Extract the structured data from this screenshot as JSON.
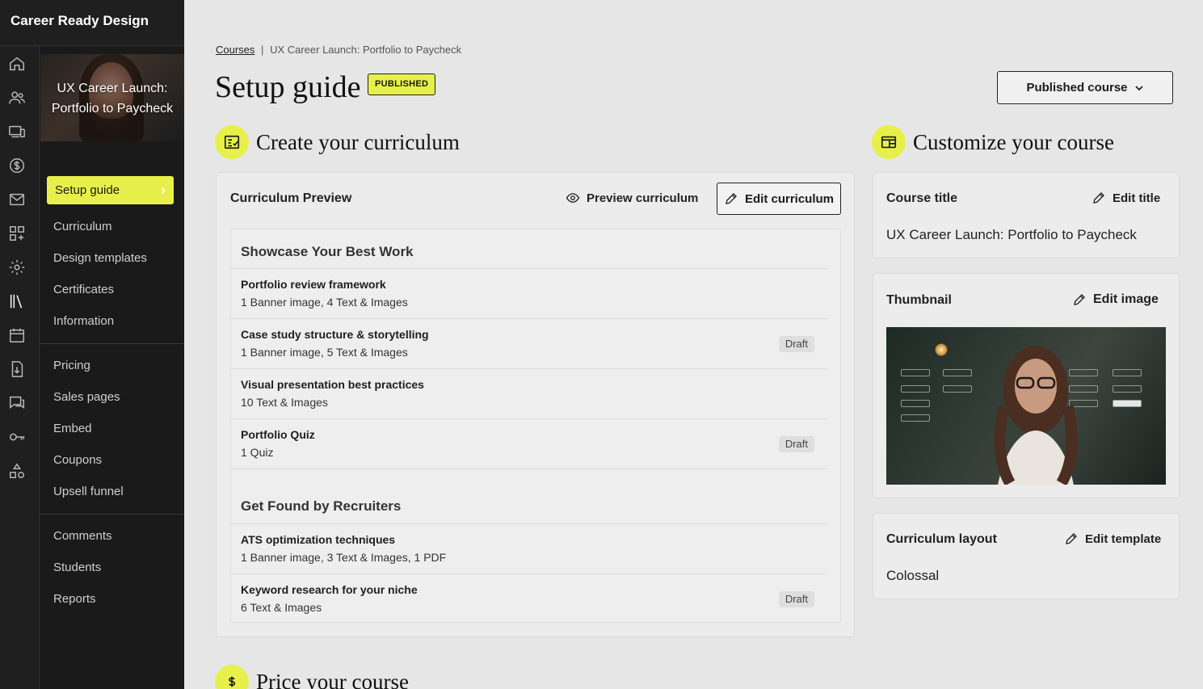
{
  "app": {
    "brand": "Career Ready Design"
  },
  "rail_icons": [
    "home-icon",
    "users-icon",
    "devices-icon",
    "dollar-icon",
    "mail-icon",
    "apps-icon",
    "gear-icon",
    "library-icon",
    "calendar-icon",
    "download-doc-icon",
    "chat-icon",
    "key-icon",
    "shapes-icon"
  ],
  "sidebar": {
    "course_card_title": "UX Career Launch: Portfolio to Paycheck",
    "active": "Setup guide",
    "group1": [
      "Curriculum",
      "Design templates",
      "Certificates",
      "Information"
    ],
    "group2": [
      "Pricing",
      "Sales pages",
      "Embed",
      "Coupons",
      "Upsell funnel"
    ],
    "group3": [
      "Comments",
      "Students",
      "Reports"
    ]
  },
  "breadcrumb": {
    "root": "Courses",
    "separator": "|",
    "current": "UX Career Launch: Portfolio to Paycheck"
  },
  "header": {
    "title": "Setup guide",
    "badge": "PUBLISHED",
    "status_button": "Published course"
  },
  "curriculum": {
    "section_title": "Create your curriculum",
    "panel_title": "Curriculum Preview",
    "preview_label": "Preview curriculum",
    "edit_label": "Edit curriculum",
    "groups": [
      {
        "title": "Showcase Your Best Work",
        "lessons": [
          {
            "title": "Portfolio review framework",
            "sub": "1 Banner image, 4 Text & Images",
            "badge": ""
          },
          {
            "title": "Case study structure & storytelling",
            "sub": "1 Banner image, 5 Text & Images",
            "badge": "Draft"
          },
          {
            "title": "Visual presentation best practices",
            "sub": "10 Text & Images",
            "badge": ""
          },
          {
            "title": "Portfolio Quiz",
            "sub": "1 Quiz",
            "badge": "Draft"
          }
        ]
      },
      {
        "title": "Get Found by Recruiters",
        "lessons": [
          {
            "title": "ATS optimization techniques",
            "sub": "1 Banner image, 3 Text & Images, 1 PDF",
            "badge": ""
          },
          {
            "title": "Keyword research for your niche",
            "sub": "6 Text & Images",
            "badge": "Draft"
          }
        ]
      }
    ]
  },
  "customize": {
    "section_title": "Customize your course",
    "course_title_label": "Course title",
    "course_title_edit": "Edit title",
    "course_title_value": "UX Career Launch: Portfolio to Paycheck",
    "thumbnail_label": "Thumbnail",
    "thumbnail_edit": "Edit image",
    "layout_label": "Curriculum layout",
    "layout_edit": "Edit template",
    "layout_value": "Colossal"
  },
  "pricing": {
    "section_title": "Price your course"
  },
  "colors": {
    "accent": "#e7f04a",
    "sidebar_bg": "#1a1a1a",
    "page_bg": "#e6e6e6"
  }
}
